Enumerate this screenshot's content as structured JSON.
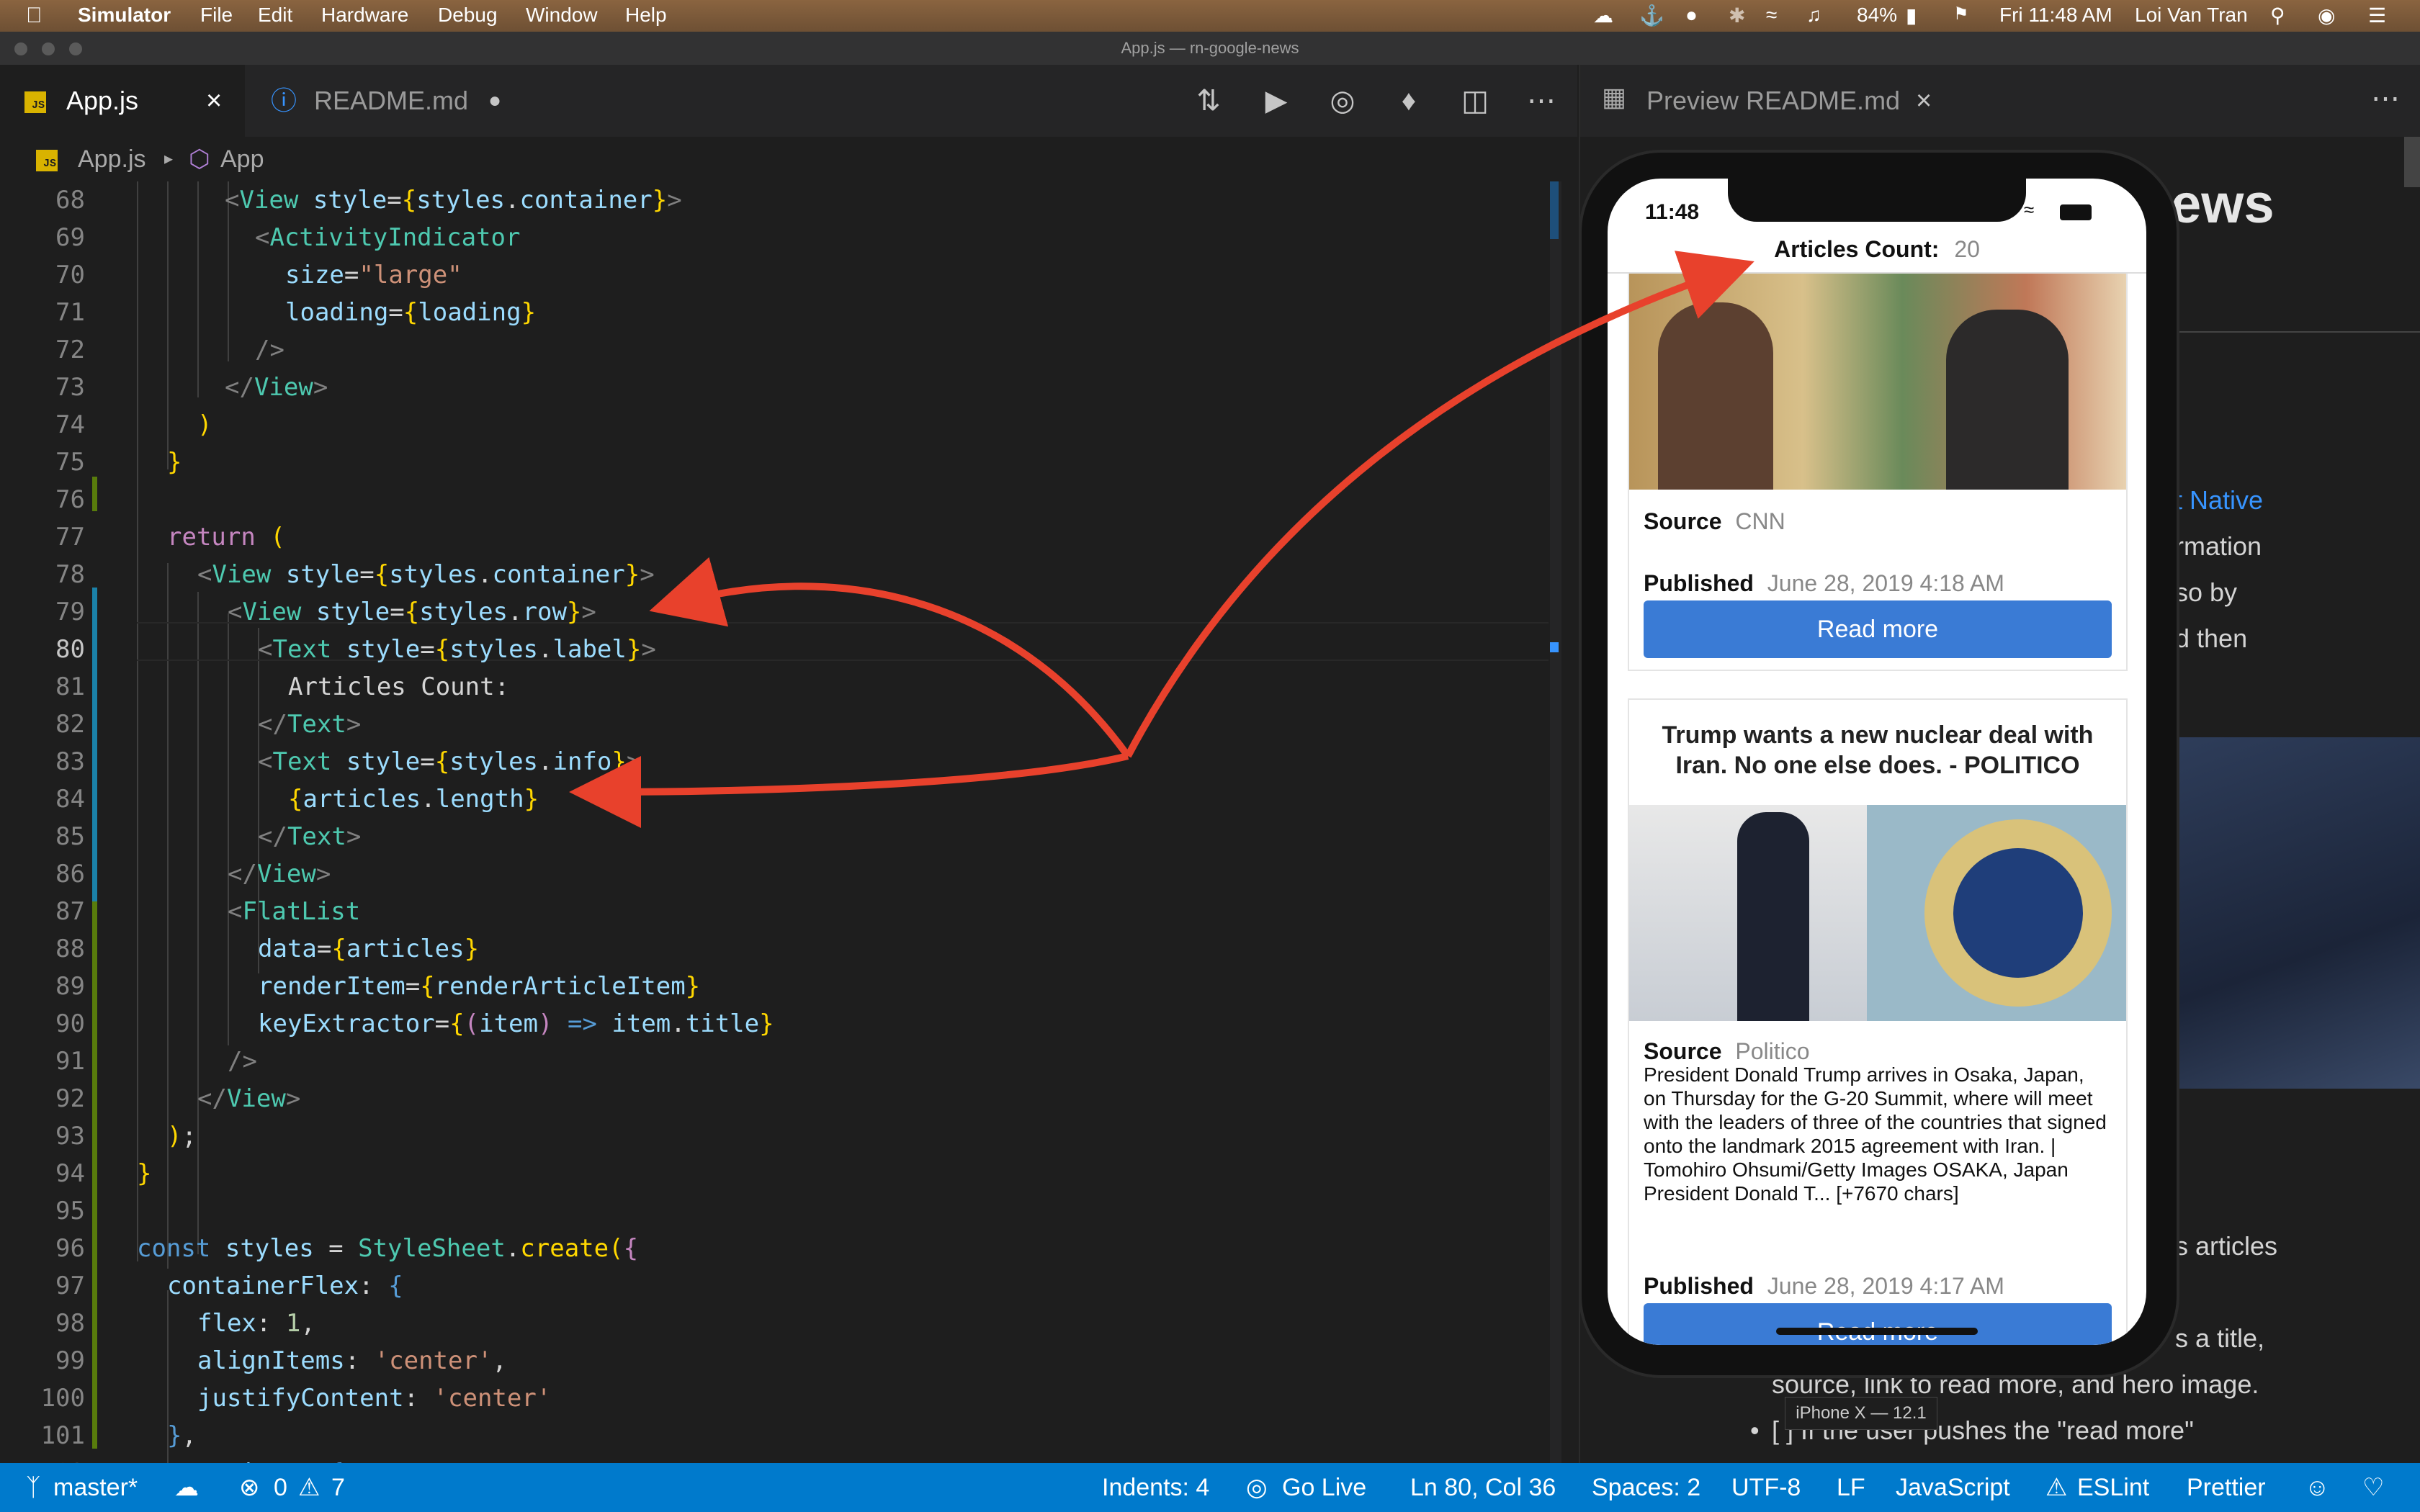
{
  "menubar": {
    "app": "Simulator",
    "items": [
      "File",
      "Edit",
      "Hardware",
      "Debug",
      "Window",
      "Help"
    ],
    "battery": "84%",
    "clock": "Fri 11:48 AM",
    "user": "Loi Van Tran"
  },
  "window": {
    "title": "App.js — rn-google-news"
  },
  "tabs": [
    {
      "label": "App.js",
      "close": "×"
    },
    {
      "label": "README.md",
      "dot": "●"
    }
  ],
  "breadcrumb": {
    "file": "App.js",
    "symbol": "App"
  },
  "editor": {
    "current_line": 80,
    "lines": [
      {
        "n": 68
      },
      {
        "n": 69
      },
      {
        "n": 70
      },
      {
        "n": 71
      },
      {
        "n": 72
      },
      {
        "n": 73
      },
      {
        "n": 74
      },
      {
        "n": 75
      },
      {
        "n": 76
      },
      {
        "n": 77
      },
      {
        "n": 78
      },
      {
        "n": 79
      },
      {
        "n": 80
      },
      {
        "n": 81
      },
      {
        "n": 82
      },
      {
        "n": 83
      },
      {
        "n": 84
      },
      {
        "n": 85
      },
      {
        "n": 86
      },
      {
        "n": 87
      },
      {
        "n": 88
      },
      {
        "n": 89
      },
      {
        "n": 90
      },
      {
        "n": 91
      },
      {
        "n": 92
      },
      {
        "n": 93
      },
      {
        "n": 94
      },
      {
        "n": 95
      },
      {
        "n": 96
      },
      {
        "n": 97
      },
      {
        "n": 98
      },
      {
        "n": 99
      },
      {
        "n": 100
      },
      {
        "n": 101
      },
      {
        "n": 102
      }
    ]
  },
  "preview": {
    "tab_label": "Preview README.md",
    "heading_fragment": "ews",
    "text_fragments": [
      "t Native",
      "rmation",
      "so by",
      "d then",
      "s articles",
      "s a title,",
      "source, link to read more, and hero image.",
      "[ ] If the user pushes the \"read more\""
    ]
  },
  "phone": {
    "time": "11:48",
    "articles_count_label": "Articles Count:",
    "articles_count": "20",
    "label_text": "iPhone X — 12.1",
    "cards": [
      {
        "source_label": "Source",
        "source": "CNN",
        "published_label": "Published",
        "published": "June 28, 2019 4:18 AM",
        "button": "Read more"
      },
      {
        "title": "Trump wants a new nuclear deal with Iran. No one else does. - POLITICO",
        "source_label": "Source",
        "source": "Politico",
        "description": "President Donald Trump arrives in Osaka, Japan, on Thursday for the G-20 Summit, where will meet with the leaders of three of the countries that signed onto the landmark 2015 agreement with Iran. | Tomohiro Ohsumi/Getty Images OSAKA, Japan President Donald T... [+7670 chars]",
        "published_label": "Published",
        "published": "June 28, 2019 4:17 AM",
        "button": "Read more"
      }
    ]
  },
  "statusbar": {
    "branch": "master*",
    "errors": "0",
    "warnings": "7",
    "indents": "Indents: 4",
    "golive": "Go Live",
    "position": "Ln 80, Col 36",
    "spaces": "Spaces: 2",
    "encoding": "UTF-8",
    "eol": "LF",
    "language": "JavaScript",
    "eslint": "ESLint",
    "prettier": "Prettier"
  },
  "colors": {
    "accent": "#007acc",
    "button": "#3a7bd5",
    "arrow": "#e8412c"
  }
}
